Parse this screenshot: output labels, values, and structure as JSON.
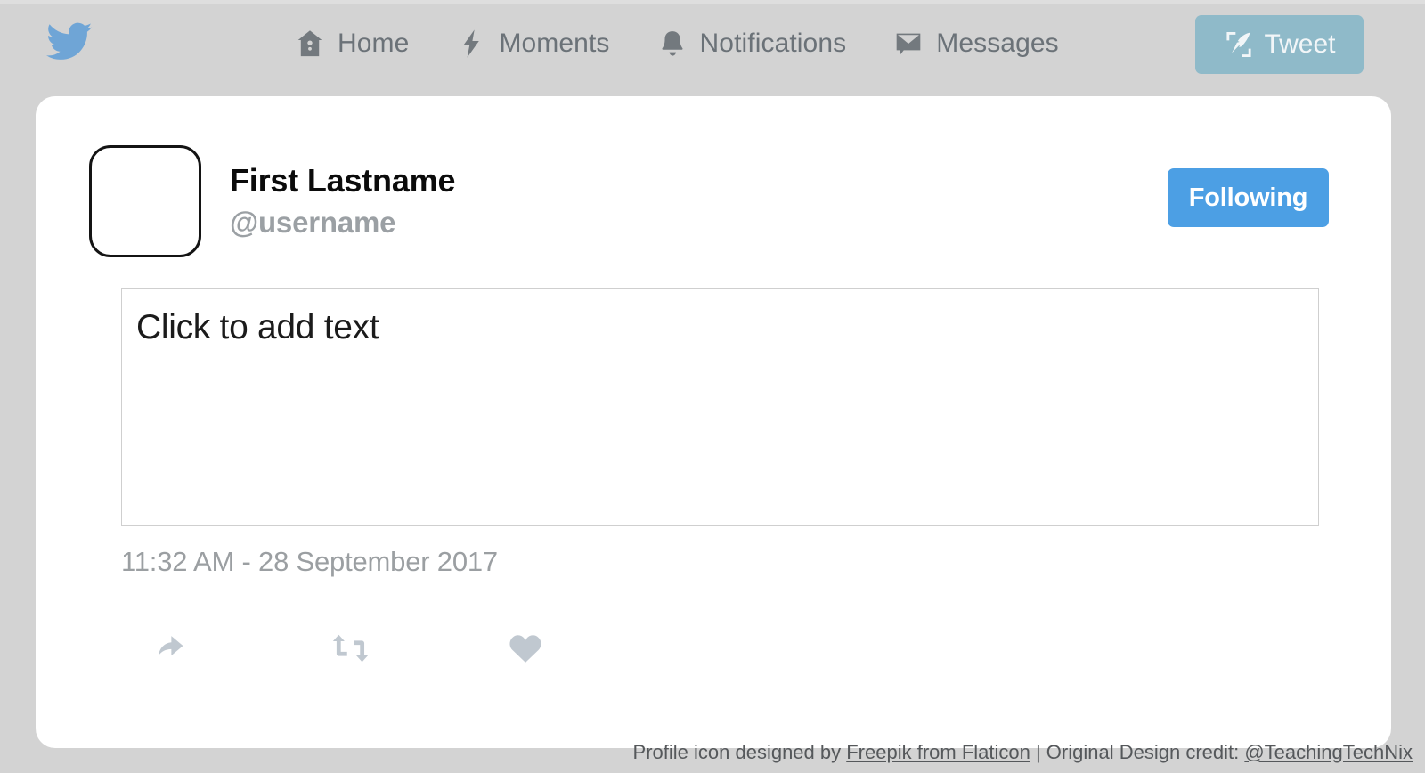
{
  "navbar": {
    "brand_icon": "twitter-bird-icon",
    "brand_color": "#6fa5d6",
    "items": [
      {
        "label": "Home",
        "icon": "home-icon"
      },
      {
        "label": "Moments",
        "icon": "lightning-bolt-icon"
      },
      {
        "label": "Notifications",
        "icon": "bell-icon"
      },
      {
        "label": "Messages",
        "icon": "envelope-icon"
      }
    ],
    "tweet_button": {
      "label": "Tweet",
      "icon": "quill-compose-icon",
      "bg_color": "#8fbac9"
    }
  },
  "card": {
    "avatar": {
      "icon": "avatar-placeholder",
      "empty": true
    },
    "display_name": "First Lastname",
    "handle": "@username",
    "follow_button": {
      "label": "Following",
      "bg_color": "#4c9fe4"
    },
    "compose": {
      "value": "",
      "placeholder": "Click to add text"
    },
    "timestamp": "11:32 AM - 28 September 2017",
    "actions": [
      {
        "name": "reply",
        "icon": "reply-arrow-icon",
        "color": "#c0c8d0"
      },
      {
        "name": "retweet",
        "icon": "retweet-icon",
        "color": "#c0c8d0"
      },
      {
        "name": "like",
        "icon": "heart-icon",
        "color": "#c0c8d0"
      }
    ]
  },
  "footer": {
    "prefix": "Profile icon designed by ",
    "link1": "Freepik from Flaticon",
    "separator": " | Original Design credit: ",
    "link2": "@TeachingTechNix"
  }
}
